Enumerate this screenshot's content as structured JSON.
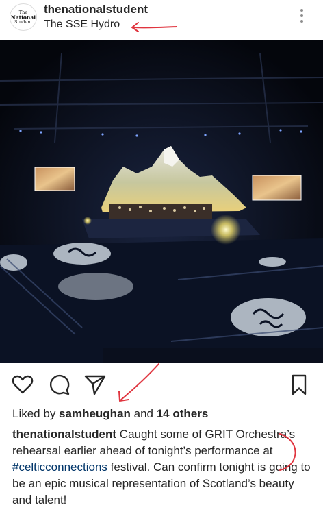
{
  "post": {
    "username": "thenationalstudent",
    "location": "The SSE Hydro",
    "avatar_text_line1": "The",
    "avatar_text_line2": "National",
    "avatar_text_line3": "Student"
  },
  "likes": {
    "prefix": "Liked by ",
    "user": "samheughan",
    "middle": " and ",
    "others": "14 others"
  },
  "caption": {
    "username": "thenationalstudent",
    "text_before": " Caught some of GRIT Orchestra’s rehearsal earlier ahead of tonight’s performance at ",
    "hashtag": "#celticconnections",
    "text_after": " festival.  Can confirm tonight is going to be an epic musical representation of Scotland’s beauty and talent!"
  },
  "icons": {
    "like": "heart-icon",
    "comment": "comment-icon",
    "share": "send-icon",
    "save": "bookmark-icon",
    "more": "more-vertical-icon"
  },
  "colors": {
    "text": "#262626",
    "hashtag": "#003569",
    "annotation": "#e0353f"
  }
}
